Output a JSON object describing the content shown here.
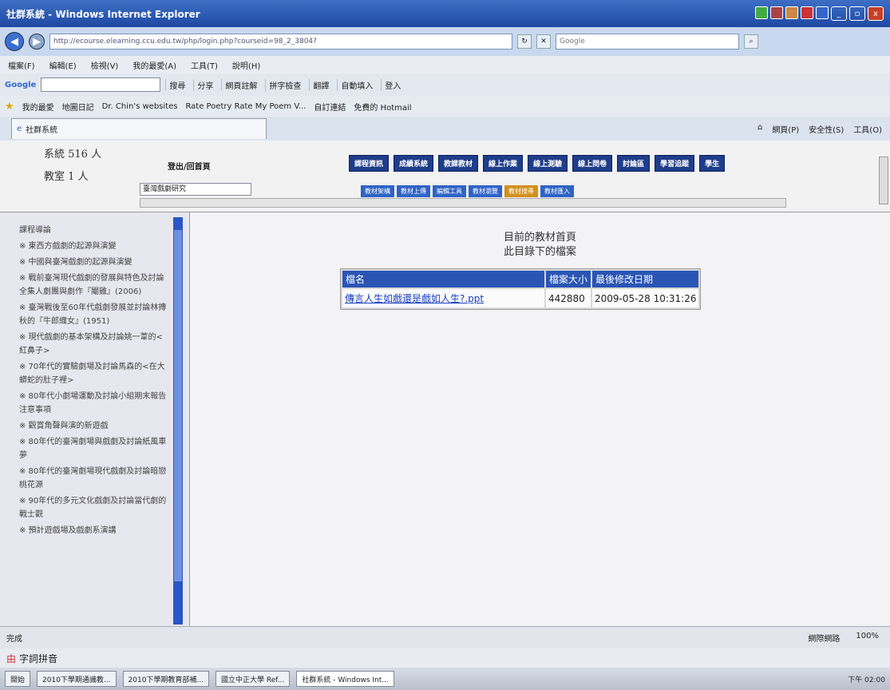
{
  "window": {
    "title": "社群系統 - Windows Internet Explorer",
    "min": "_",
    "max": "▫",
    "close": "x"
  },
  "address": {
    "url": "http://ecourse.elearning.ccu.edu.tw/php/login.php?courseid=98_2_3804?",
    "search_placeholder": "Google"
  },
  "menu": [
    "檔案(F)",
    "編輯(E)",
    "檢視(V)",
    "我的最愛(A)",
    "工具(T)",
    "說明(H)"
  ],
  "gtoolbar": {
    "brand": "Google",
    "items": [
      "搜尋",
      "分享",
      "網頁註解",
      "拼字檢查",
      "翻譯",
      "自動填入",
      "登入"
    ]
  },
  "favorites": {
    "label": "我的最愛",
    "items": [
      "地圖日記",
      "Dr. Chin's websites",
      "Rate Poetry Rate My Poem V...",
      "自訂連結",
      "免費的 Hotmail"
    ]
  },
  "tab": {
    "label": "社群系統",
    "tools": [
      "網頁(P)",
      "安全性(S)",
      "工具(O)"
    ]
  },
  "header": {
    "online": "系統 516 人",
    "course_count": "教室 1 人",
    "course_label": "登出/回首頁",
    "course_select": "臺灣戲劇研究",
    "nav": [
      "課程資訊",
      "成績系統",
      "教課教材",
      "線上作業",
      "線上測驗",
      "線上問卷",
      "討論區",
      "學習追蹤",
      "學生"
    ],
    "subnav": [
      "教材架構",
      "教材上傳",
      "編輯工具",
      "教材瀏覽",
      "教材搜尋",
      "教材匯入"
    ]
  },
  "sidebar": {
    "items": [
      "課程導論",
      "※ 東西方戲劇的起源與演變",
      "※ 中國與臺灣戲劇的起源與演變",
      "※ 戰前臺灣現代戲劇的發展與特色及討論全集人劇團與劇作『閹雞』(2006)",
      "※ 臺灣戰後至60年代戲劇發展並討論林摶秋的『牛郎織女』(1951)",
      "※ 現代戲劇的基本架構及討論姚一葦的<紅鼻子>",
      "※ 70年代的實驗劇場及討論馬森的<在大蟒蛇的肚子裡>",
      "※ 80年代小劇場運動及討論小組期末報告注意事項",
      "※ 觀賞角聲與演的新遊戲",
      "※ 80年代的臺灣劇場與戲劇及討論紙風車夢",
      "※ 80年代的臺灣劇場現代戲劇及討論暗戀桃花源",
      "※ 90年代的多元文化戲劇及討論當代劇的戰士觀",
      "※ 預計遊戲場及戲劇系演講"
    ]
  },
  "main": {
    "heading1": "目前的教材首頁",
    "heading2": "此目錄下的檔案",
    "columns": [
      "檔名",
      "檔案大小",
      "最後修改日期"
    ],
    "rows": [
      {
        "name": "傳言人生如戲還是戲如人生?.ppt",
        "size": "442880",
        "date": "2009-05-28 10:31:26"
      }
    ]
  },
  "status": {
    "text": "完成",
    "zone": "網際網路",
    "zoom": "100%"
  },
  "ime": {
    "label": "字詞拼音"
  },
  "taskbar": {
    "start": "開始",
    "tasks": [
      "2010下學期通識教...",
      "2010下學期教育部補...",
      "國立中正大學 Ref...",
      "社群系統 - Windows Int..."
    ],
    "clock": "下午 02:00"
  }
}
